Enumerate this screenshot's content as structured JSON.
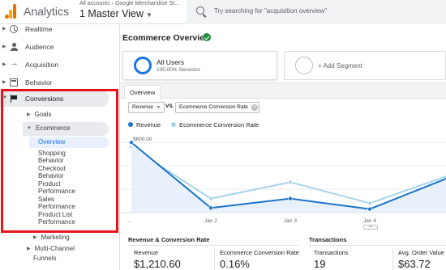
{
  "header": {
    "app_title": "Analytics",
    "account_path": "All accounts › Google Merchandise St...",
    "view_name": "1 Master View",
    "search_placeholder": "Try searching for \"acquisition overview\""
  },
  "sidebar": {
    "items": [
      {
        "label": "Realtime",
        "icon": "clock-icon"
      },
      {
        "label": "Audience",
        "icon": "person-icon"
      },
      {
        "label": "Acquisition",
        "icon": "acquisition-icon"
      },
      {
        "label": "Behavior",
        "icon": "behavior-icon"
      },
      {
        "label": "Conversions",
        "icon": "flag-icon",
        "expanded": true
      }
    ],
    "conversions": {
      "goals": "Goals",
      "ecommerce": "Ecommerce",
      "ecommerce_children": [
        "Overview",
        "Shopping",
        "Behavior",
        "Checkout",
        "Behavior",
        "Product",
        "Performance",
        "Sales",
        "Performance",
        "Product List",
        "Performance"
      ],
      "marketing": "Marketing",
      "multichannel_line1": "Multi-Channel",
      "multichannel_line2": "Funnels"
    },
    "highlight_color": "#e8141c"
  },
  "main": {
    "title": "Ecommerce Overview",
    "segments": {
      "all_users": "All Users",
      "all_users_sub": "100.00% Sessions",
      "add_segment": "+ Add Segment"
    },
    "tab": "Overview",
    "metric1": "Revenue",
    "vs_label": "VS.",
    "metric2": "Ecommerce Conversion Rate",
    "legend": [
      {
        "label": "Revenue",
        "color": "#1a73c8"
      },
      {
        "label": "Ecommerce Conversion Rate",
        "color": "#a6d4ec"
      }
    ],
    "sections": {
      "revenue_title": "Revenue & Conversion Rate",
      "transactions_title": "Transactions"
    },
    "metrics": [
      {
        "label": "Revenue",
        "value": "$1,210.60"
      },
      {
        "label": "Ecommerce Conversion Rate",
        "value": "0.16%"
      },
      {
        "label": "Transactions",
        "value": "19"
      },
      {
        "label": "Avg. Order Value",
        "value": "$63.72"
      }
    ]
  },
  "chart_data": {
    "type": "line",
    "x": [
      "...",
      "Jan 2",
      "Jan 3",
      "Jan 4",
      "..."
    ],
    "y_ticks": [
      "$600.00",
      "$400.00",
      "$200.00"
    ],
    "ylim": [
      0,
      650
    ],
    "series": [
      {
        "name": "Revenue",
        "values": [
          600,
          40,
          120,
          30,
          290
        ]
      },
      {
        "name": "Ecommerce Conversion Rate",
        "values": [
          560,
          120,
          260,
          80,
          310
        ]
      }
    ]
  }
}
